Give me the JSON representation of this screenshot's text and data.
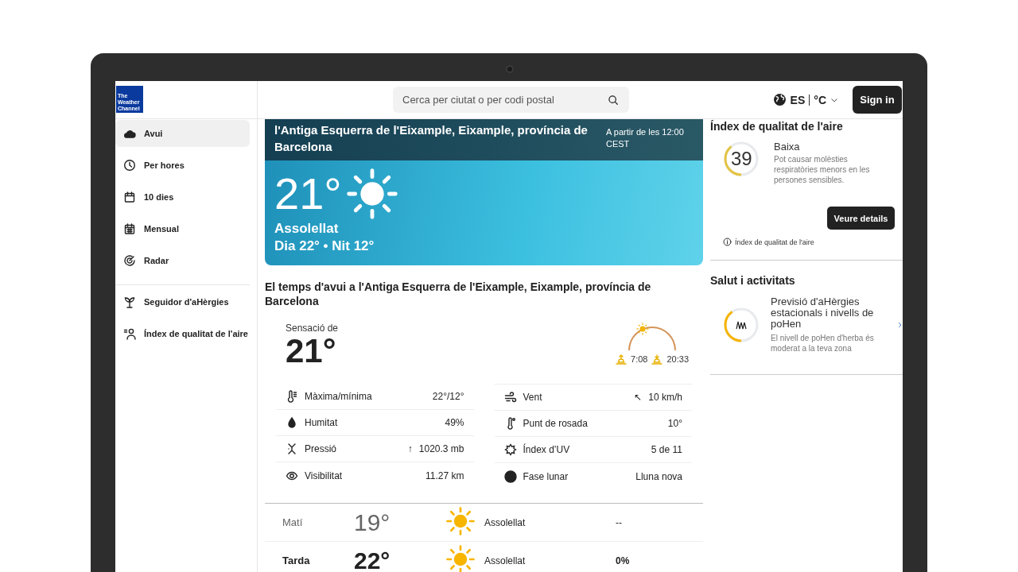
{
  "header": {
    "logo": [
      "The",
      "Weather",
      "Channel"
    ],
    "search": {
      "placeholder": "Cerca per ciutat o per codi postal"
    },
    "language": "ES",
    "unit": "°C",
    "sign_in": "Sign in"
  },
  "sidebar": {
    "groups": [
      [
        {
          "label": "Avui",
          "selected": true
        },
        {
          "label": "Per hores",
          "selected": false
        },
        {
          "label": "10 dies",
          "selected": false
        },
        {
          "label": "Mensual",
          "selected": false
        },
        {
          "label": "Radar",
          "selected": false
        }
      ],
      [
        {
          "label": "Seguidor d'aHèrgies",
          "selected": false
        },
        {
          "label": "Índex de qualitat de l'aire",
          "selected": false
        }
      ]
    ]
  },
  "hero": {
    "location": "l'Antiga Esquerra de l'Eixample, Eixample, província de Barcelona",
    "as_of": "A partir de les 12:00 CEST",
    "temperature": "21°",
    "condition": "Assolellat",
    "day_night": "Dia 22° • Nit 12°"
  },
  "today": {
    "heading": "El temps d'avui a l'Antiga Esquerra de l'Eixample, Eixample, província de Barcelona",
    "feels_like_label": "Sensació de",
    "feels_like": "21°",
    "sunrise": "7:08",
    "sunset": "20:33",
    "details": [
      [
        {
          "label": "Màxima/mínima",
          "value": "22°/12°"
        },
        {
          "label": "Humitat",
          "value": "49%"
        },
        {
          "label": "Pressió",
          "trend": "↑",
          "value": "1020.3 mb"
        },
        {
          "label": "Visibilitat",
          "value": "11.27 km"
        }
      ],
      [
        {
          "label": "Vent",
          "trend": "↖",
          "value": "10 km/h"
        },
        {
          "label": "Punt de rosada",
          "value": "10°"
        },
        {
          "label": "Índex d’UV",
          "value": "5 de 11"
        },
        {
          "label": "Fase lunar",
          "value": "Lluna nova"
        }
      ]
    ],
    "periods": [
      {
        "name": "Matí",
        "temperature": "19°",
        "condition": "Assolellat",
        "precipitation": "--",
        "selected": false
      },
      {
        "name": "Tarda",
        "temperature": "22°",
        "condition": "Assolellat",
        "precipitation": "0%",
        "selected": true
      }
    ]
  },
  "air_quality": {
    "heading": "Índex de qualitat de l'aire",
    "value": "39",
    "level": 0.39,
    "category": "Baixa",
    "description": "Pot causar molèsties respiratòries menors en les persones sensibles.",
    "button": "Veure details",
    "footnote": "Índex de qualitat de l'aire"
  },
  "health": {
    "heading": "Salut i activitats",
    "title": "Previsió d'aHèrgies estacionals i nivells de poHen",
    "description": "El nivell de poHen d'herba és moderat a la teva zona",
    "level": 0.4
  }
}
